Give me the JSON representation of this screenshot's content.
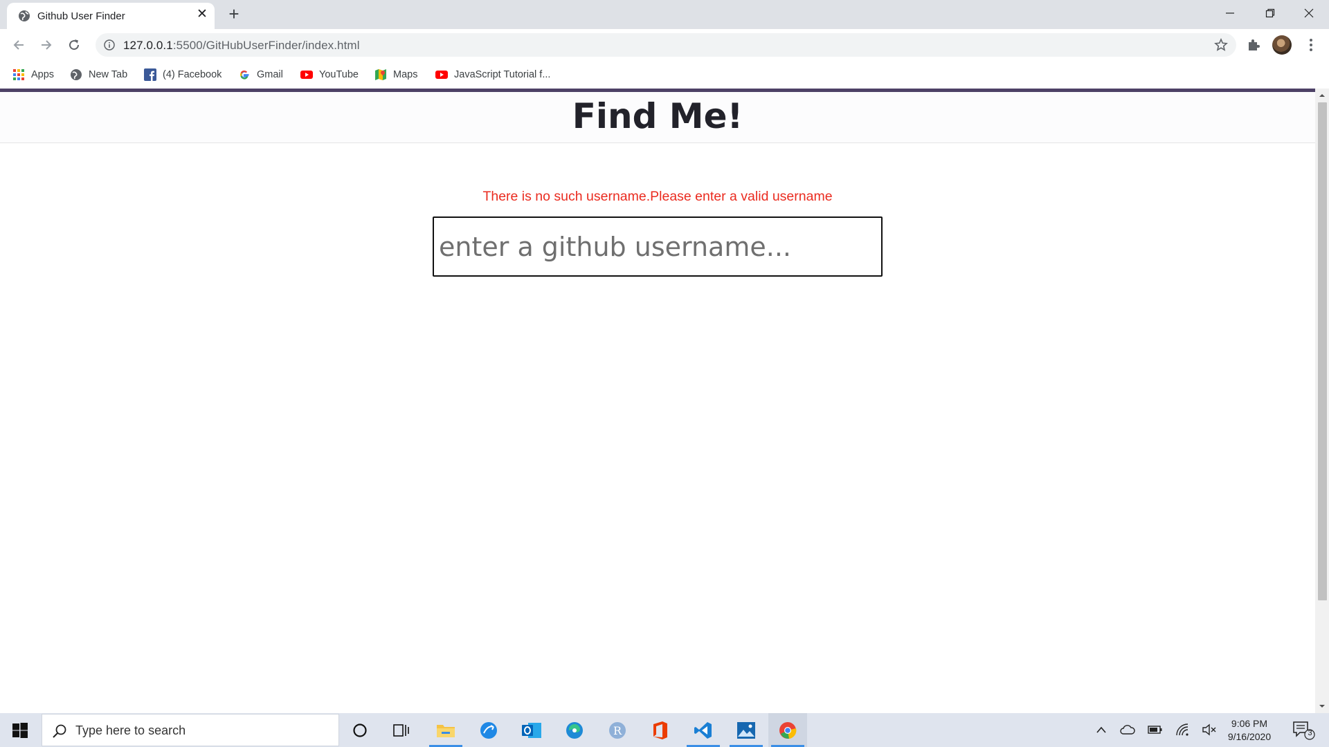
{
  "browser": {
    "tab_title": "Github User Finder",
    "tab_close": "✕",
    "new_tab": "+",
    "url_host": "127.0.0.1",
    "url_path": ":5500/GitHubUserFinder/index.html"
  },
  "bookmarks": {
    "apps": "Apps",
    "new_tab": "New Tab",
    "facebook": "(4) Facebook",
    "gmail": "Gmail",
    "youtube": "YouTube",
    "maps": "Maps",
    "js_tutorial": "JavaScript Tutorial f..."
  },
  "page": {
    "title": "Find Me!",
    "error": "There is no such username.Please enter a valid username",
    "search_placeholder": "enter a github username...",
    "search_value": ""
  },
  "taskbar": {
    "search_placeholder": "Type here to search",
    "time": "9:06 PM",
    "date": "9/16/2020",
    "notification_count": "3"
  },
  "colors": {
    "accent_bar": "#4d4166",
    "error_text": "#ea2b1f",
    "taskbar_bg": "#dfe4ee"
  }
}
